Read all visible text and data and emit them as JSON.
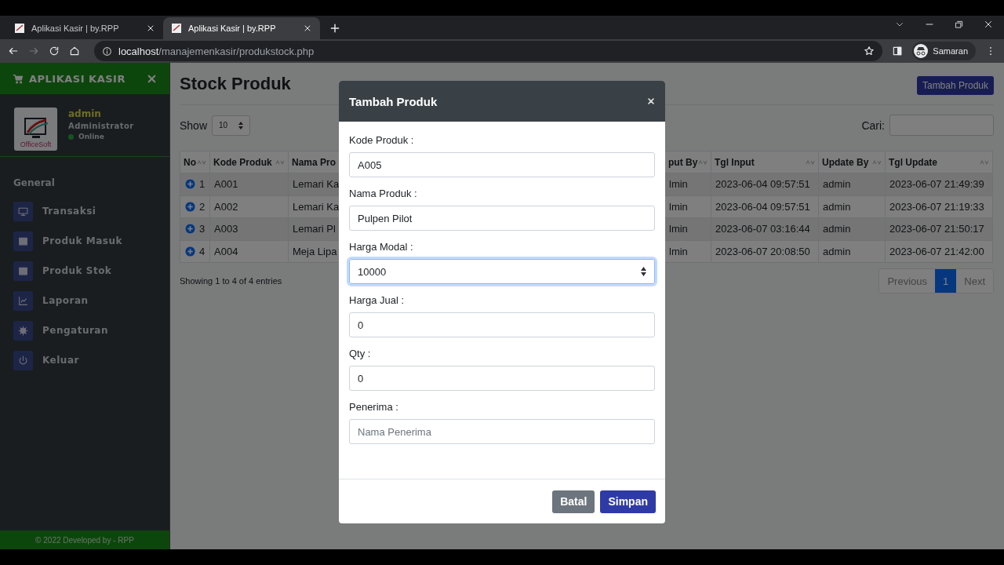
{
  "browser": {
    "tabs": [
      {
        "title": "Aplikasi Kasir | by.RPP",
        "selected": false
      },
      {
        "title": "Aplikasi Kasir | by.RPP",
        "selected": true
      }
    ],
    "url_host": "localhost",
    "url_path": "/manajemenkasir/produkstock.php",
    "profile": "Samaran"
  },
  "sidebar": {
    "brand": "APLIKASI KASIR",
    "logo_text": "OfficeSoft",
    "user": {
      "name": "admin",
      "role": "Administrator",
      "status": "Online"
    },
    "section": "General",
    "items": [
      {
        "label": "Transaksi"
      },
      {
        "label": "Produk Masuk"
      },
      {
        "label": "Produk Stok"
      },
      {
        "label": "Laporan"
      },
      {
        "label": "Pengaturan"
      },
      {
        "label": "Keluar"
      }
    ],
    "footer": "© 2022 Developed by - RPP"
  },
  "page": {
    "title": "Stock Produk",
    "add_button": "Tambah Produk",
    "show_label": "Show",
    "page_length": "10",
    "search_label": "Cari:",
    "table": {
      "columns": [
        {
          "label": "No",
          "sort_icon": true
        },
        {
          "label": "Kode Produk",
          "sort_icon": true
        },
        {
          "label": "Nama Pro",
          "sort_icon": false
        },
        {
          "label": "put By",
          "sort_icon": true
        },
        {
          "label": "Tgl Input",
          "sort_icon": true
        },
        {
          "label": "Update By",
          "sort_icon": true
        },
        {
          "label": "Tgl Update",
          "sort_icon": true
        }
      ],
      "rows": [
        {
          "cells": [
            "1",
            "A001",
            "Lemari Ka",
            "lmin",
            "2023-06-04 09:57:51",
            "admin",
            "2023-06-07 21:49:39"
          ]
        },
        {
          "cells": [
            "2",
            "A002",
            "Lemari Ka",
            "lmin",
            "2023-06-04 09:57:51",
            "admin",
            "2023-06-07 21:19:33"
          ]
        },
        {
          "cells": [
            "3",
            "A003",
            "Lemari Pl",
            "lmin",
            "2023-06-07 03:16:44",
            "admin",
            "2023-06-07 21:50:17"
          ]
        },
        {
          "cells": [
            "4",
            "A004",
            "Meja Lipa",
            "lmin",
            "2023-06-07 20:08:50",
            "admin",
            "2023-06-07 21:42:00"
          ]
        }
      ]
    },
    "info": "Showing 1 to 4 of 4 entries",
    "pagination": [
      {
        "label": "Previous",
        "selected": false
      },
      {
        "label": "1",
        "selected": true
      },
      {
        "label": "Next",
        "selected": false
      }
    ]
  },
  "modal": {
    "title": "Tambah Produk",
    "fields": [
      {
        "label": "Kode Produk :",
        "value": "A005",
        "kind": "text",
        "focused": false
      },
      {
        "label": "Nama Produk :",
        "value": "Pulpen Pilot",
        "kind": "text",
        "focused": false
      },
      {
        "label": "Harga Modal :",
        "value": "10000",
        "kind": "number",
        "focused": true
      },
      {
        "label": "Harga Jual :",
        "value": "0",
        "kind": "text",
        "focused": false
      },
      {
        "label": "Qty :",
        "value": "0",
        "kind": "text",
        "focused": false
      },
      {
        "label": "Penerima :",
        "placeholder": "Nama Penerima",
        "kind": "text",
        "focused": false
      }
    ],
    "buttons": [
      {
        "label": "Batal",
        "kind": "secondary"
      },
      {
        "label": "Simpan",
        "kind": "primary"
      }
    ]
  }
}
